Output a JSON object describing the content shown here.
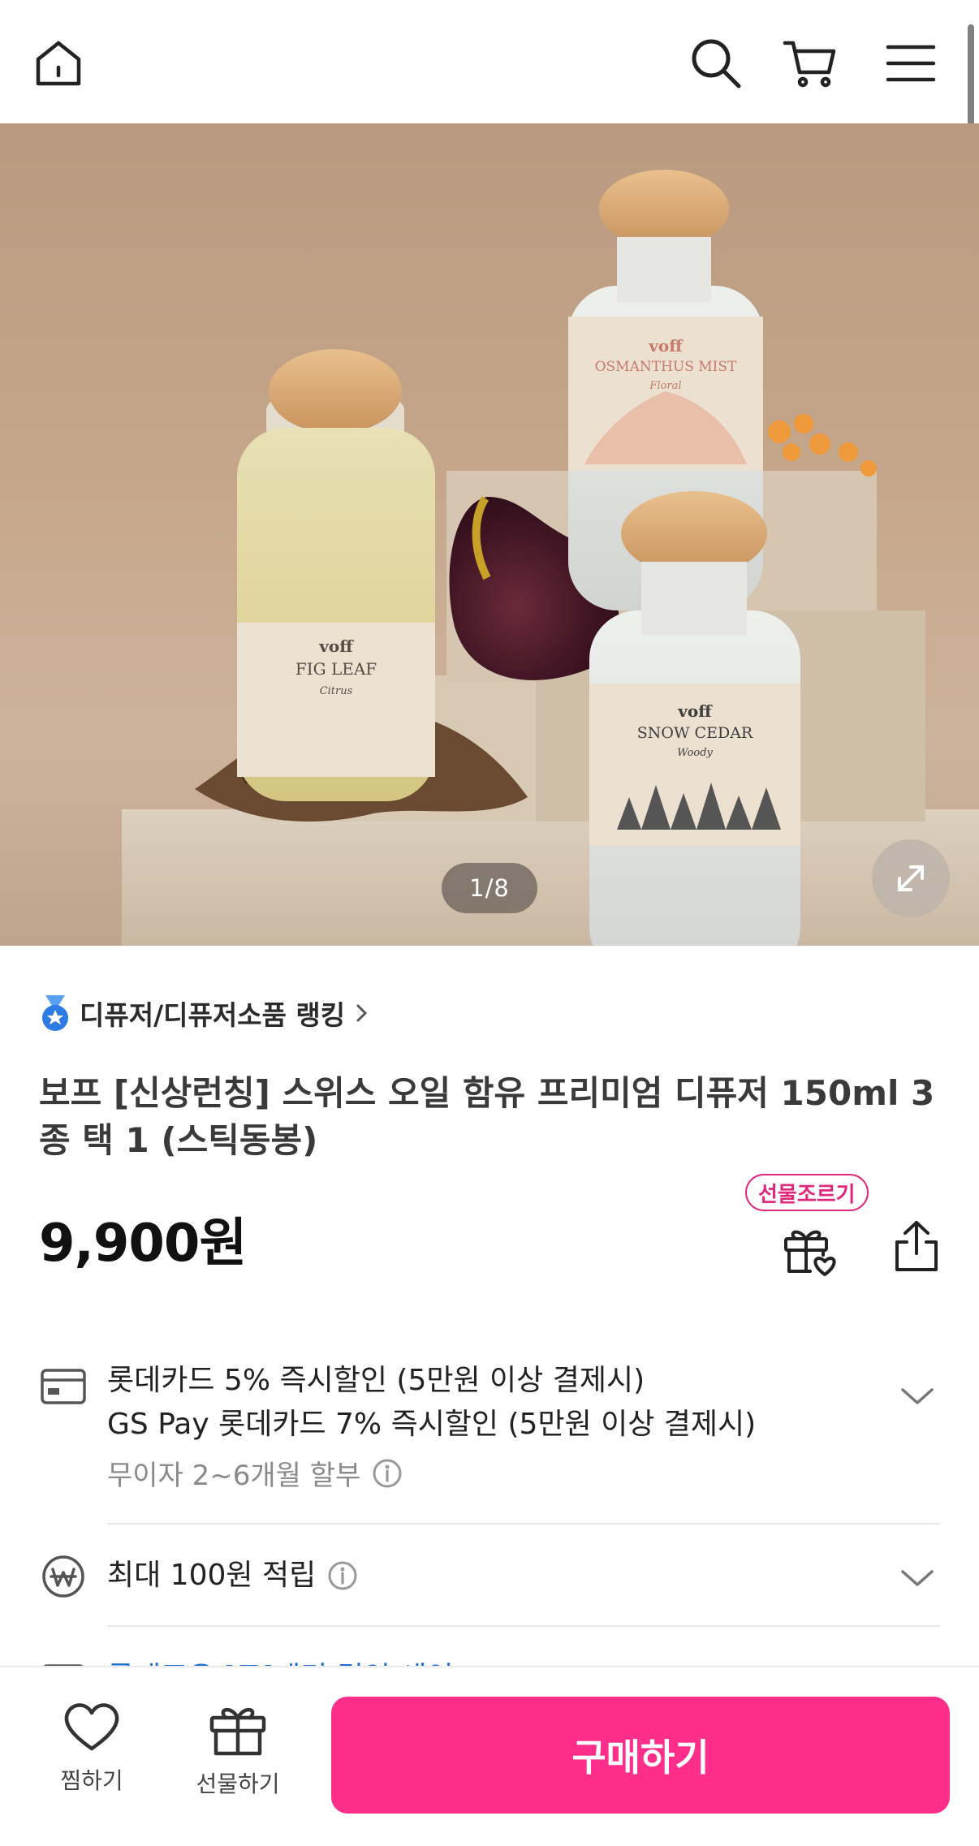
{
  "header": {
    "icons": [
      "home-icon",
      "search-icon",
      "cart-icon",
      "menu-icon"
    ]
  },
  "hero": {
    "counter": "1/8",
    "bottles": [
      {
        "brand": "voff",
        "name": "FIG LEAF",
        "note": "Citrus"
      },
      {
        "brand": "voff",
        "name": "OSMANTHUS MIST",
        "note": "Floral"
      },
      {
        "brand": "voff",
        "name": "SNOW CEDAR",
        "note": "Woody"
      }
    ]
  },
  "product": {
    "ranking": "디퓨저/디퓨저소품 랭킹",
    "title": "보프 [신상런칭] 스위스 오일 함유 프리미엄 디퓨저 150ml 3종 택 1 (스틱동봉)",
    "price": "9,900원",
    "gift_badge": "선물조르기"
  },
  "benefits": {
    "card_line1": "롯데카드 5% 즉시할인 (5만원 이상 결제시)",
    "card_line2": "GS Pay 롯데카드 7% 즉시할인 (5만원 이상 결제시)",
    "installment": "무이자 2~6개월 할부",
    "points": "최대 100원 적립",
    "next_partial": "롯데조은 [도]레리 결인 세인"
  },
  "bottom_bar": {
    "wish": "찜하기",
    "gift": "선물하기",
    "buy": "구매하기"
  },
  "colors": {
    "accent": "#ff2e8b",
    "badge": "#e0287d"
  }
}
